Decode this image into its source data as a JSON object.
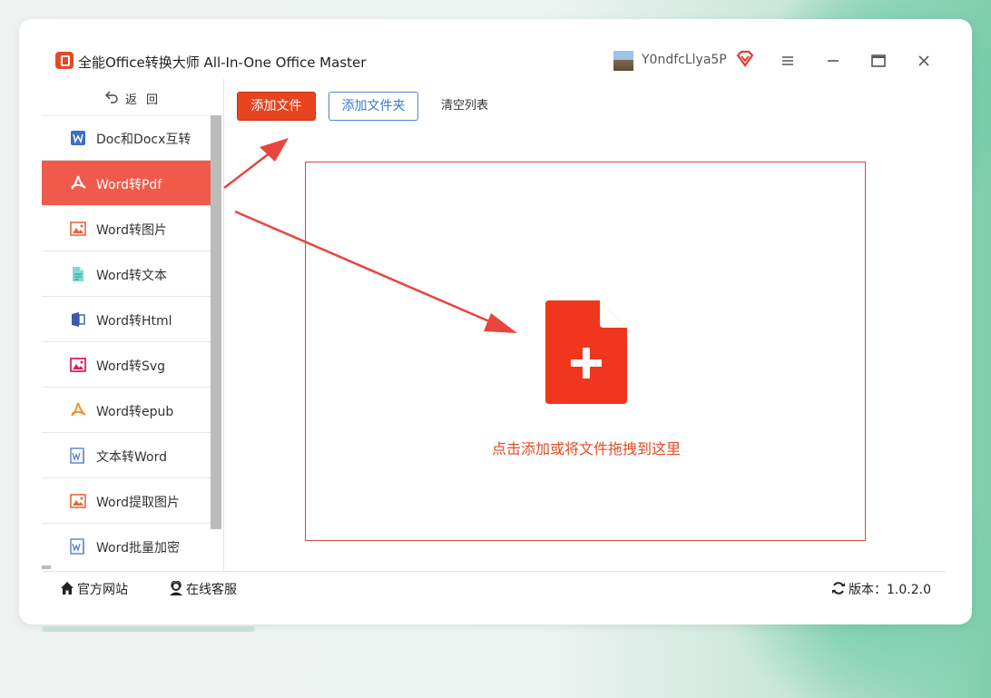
{
  "app": {
    "title": "全能Office转换大师 All-In-One Office Master",
    "username": "Y0ndfcLlya5P"
  },
  "sidebar": {
    "back_label": "返回",
    "items": [
      {
        "label": "Doc和Docx互转",
        "icon": "word-doc-icon"
      },
      {
        "label": "Word转Pdf",
        "icon": "pdf-icon",
        "active": true
      },
      {
        "label": "Word转图片",
        "icon": "image-icon"
      },
      {
        "label": "Word转文本",
        "icon": "text-file-icon"
      },
      {
        "label": "Word转Html",
        "icon": "html-icon"
      },
      {
        "label": "Word转Svg",
        "icon": "svg-image-icon"
      },
      {
        "label": "Word转epub",
        "icon": "epub-icon"
      },
      {
        "label": "文本转Word",
        "icon": "word-icon"
      },
      {
        "label": "Word提取图片",
        "icon": "image-icon"
      },
      {
        "label": "Word批量加密",
        "icon": "word-icon"
      }
    ]
  },
  "toolbar": {
    "add_file": "添加文件",
    "add_folder": "添加文件夹",
    "clear_list": "清空列表"
  },
  "dropzone": {
    "hint": "点击添加或将文件拖拽到这里",
    "icon": "add-file-icon"
  },
  "footer": {
    "website": "官方网站",
    "support": "在线客服",
    "version": "版本：1.0.2.0"
  },
  "colors": {
    "accent": "#e8441f",
    "active_item": "#f05a4a",
    "folder_button": "#3a7bc8",
    "annotation_arrow": "#e8453c"
  }
}
